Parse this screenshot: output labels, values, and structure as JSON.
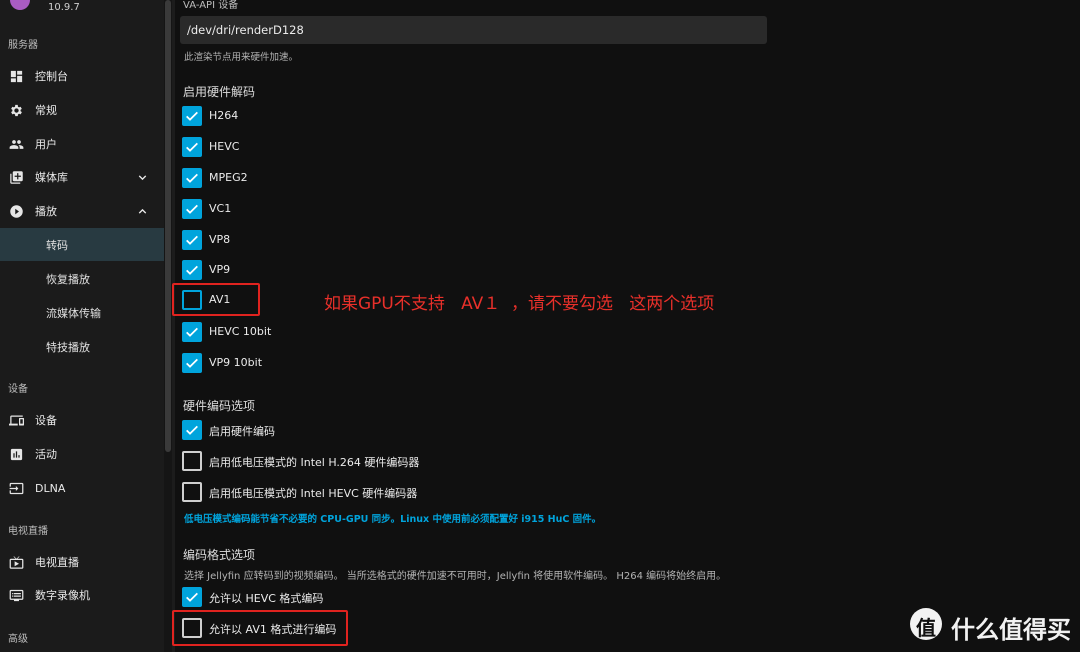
{
  "app": {
    "version": "10.9.7"
  },
  "sidebar": {
    "sections": {
      "server": "服务器",
      "devices": "设备",
      "livetv": "电视直播",
      "advanced": "高级"
    },
    "items": {
      "dashboard": "控制台",
      "general": "常规",
      "users": "用户",
      "libraries": "媒体库",
      "playback": "播放",
      "transcoding": "转码",
      "resume": "恢复播放",
      "streaming": "流媒体传输",
      "trickplay": "特技播放",
      "devices": "设备",
      "activity": "活动",
      "dlna": "DLNA",
      "livetv": "电视直播",
      "dvr": "数字录像机"
    }
  },
  "vaapi": {
    "label": "VA-API 设备",
    "value": "/dev/dri/renderD128",
    "help": "此渲染节点用来硬件加速。"
  },
  "decoding": {
    "heading": "启用硬件解码",
    "codecs": [
      {
        "label": "H264",
        "checked": true
      },
      {
        "label": "HEVC",
        "checked": true
      },
      {
        "label": "MPEG2",
        "checked": true
      },
      {
        "label": "VC1",
        "checked": true
      },
      {
        "label": "VP8",
        "checked": true
      },
      {
        "label": "VP9",
        "checked": true
      },
      {
        "label": "AV1",
        "checked": false
      },
      {
        "label": "HEVC 10bit",
        "checked": true
      },
      {
        "label": "VP9 10bit",
        "checked": true
      }
    ]
  },
  "encoding": {
    "heading": "硬件编码选项",
    "options": [
      {
        "label": "启用硬件编码",
        "checked": true
      },
      {
        "label": "启用低电压模式的 Intel H.264 硬件编码器",
        "checked": false
      },
      {
        "label": "启用低电压模式的 Intel HEVC 硬件编码器",
        "checked": false
      }
    ],
    "note": "低电压模式编码能节省不必要的 CPU-GPU 同步。Linux 中使用前必须配置好 i915 HuC 固件。"
  },
  "format": {
    "heading": "编码格式选项",
    "help": "选择 Jellyfin 应转码到的视频编码。 当所选格式的硬件加速不可用时，Jellyfin 将使用软件编码。 H264 编码将始终启用。",
    "options": [
      {
        "label": "允许以 HEVC 格式编码",
        "checked": true
      },
      {
        "label": "允许以 AV1 格式进行编码",
        "checked": false
      }
    ]
  },
  "annotation": "如果GPU不支持   AV１  ，请不要勾选   这两个选项",
  "watermark": {
    "mark": "值",
    "text": "什么值得买"
  },
  "colors": {
    "accent": "#00a4dc",
    "annotation": "#e0231f",
    "sidebar_active": "#283a41"
  }
}
